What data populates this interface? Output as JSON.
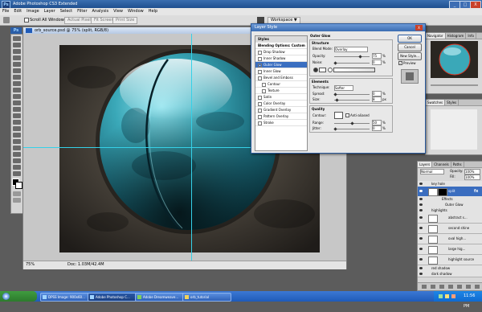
{
  "window": {
    "title": "Adobe Photoshop CS3 Extended",
    "app_logo": "Ps",
    "min": "_",
    "max": "□",
    "close": "X"
  },
  "menu": [
    "File",
    "Edit",
    "Image",
    "Layer",
    "Select",
    "Filter",
    "Analysis",
    "View",
    "Window",
    "Help"
  ],
  "options": {
    "scroll_all": "Scroll All Windows",
    "actual_pixels": "Actual Pixels",
    "fit_screen": "Fit Screen",
    "print_size": "Print Size",
    "workspace": "Workspace ▼"
  },
  "document": {
    "title": "orb_source.psd @ 75% (split, RGB/8)",
    "zoom": "75%",
    "status": "Doc: 1.03M/42.4M"
  },
  "dialog": {
    "title": "Layer Style",
    "styles_header": "Styles",
    "blending_options": "Blending Options: Custom",
    "effects": [
      {
        "label": "Drop Shadow",
        "checked": false
      },
      {
        "label": "Inner Shadow",
        "checked": false
      },
      {
        "label": "Outer Glow",
        "checked": true
      },
      {
        "label": "Inner Glow",
        "checked": false
      },
      {
        "label": "Bevel and Emboss",
        "checked": false
      },
      {
        "label": "Contour",
        "checked": false
      },
      {
        "label": "Texture",
        "checked": false
      },
      {
        "label": "Satin",
        "checked": false
      },
      {
        "label": "Color Overlay",
        "checked": false
      },
      {
        "label": "Gradient Overlay",
        "checked": false
      },
      {
        "label": "Pattern Overlay",
        "checked": false
      },
      {
        "label": "Stroke",
        "checked": false
      }
    ],
    "section_title": "Outer Glow",
    "structure": {
      "title": "Structure",
      "blend_mode_label": "Blend Mode:",
      "blend_mode": "Overlay",
      "opacity_label": "Opacity:",
      "opacity": "75",
      "noise_label": "Noise:",
      "noise": "0",
      "unit": "%",
      "opacity_level": 0.75
    },
    "elements": {
      "title": "Elements",
      "technique_label": "Technique:",
      "technique": "Softer",
      "spread_label": "Spread:",
      "spread": "0",
      "size_label": "Size:",
      "size": "8",
      "px": "px",
      "size_level": 0.04
    },
    "quality": {
      "title": "Quality",
      "contour_label": "Contour:",
      "anti_aliased": "Anti-aliased",
      "range_label": "Range:",
      "range": "50",
      "jitter_label": "Jitter:",
      "jitter": "0",
      "unit": "%",
      "range_level": 0.5
    },
    "buttons": {
      "ok": "OK",
      "cancel": "Cancel",
      "new_style": "New Style...",
      "preview": "Preview"
    },
    "preview_checked": true
  },
  "panels": {
    "navigator_tabs": [
      "Navigator",
      "Histogram",
      "Info"
    ],
    "swatch_tabs": [
      "Swatches",
      "Styles"
    ],
    "layer_tabs": [
      "Layers",
      "Channels",
      "Paths"
    ],
    "layer_blend": "Normal",
    "opacity_label": "Opacity:",
    "opacity": "100%",
    "fill_label": "Fill:",
    "fill": "100%",
    "layers": [
      {
        "name": "key hole",
        "kind": "group"
      },
      {
        "name": "split",
        "kind": "layer",
        "selected": true
      },
      {
        "name": "Effects",
        "kind": "sub"
      },
      {
        "name": "Outer Glow",
        "kind": "sub"
      },
      {
        "name": "highlights",
        "kind": "group"
      },
      {
        "name": "abstract s...",
        "kind": "layer"
      },
      {
        "name": "second shine",
        "kind": "layer"
      },
      {
        "name": "oval high...",
        "kind": "layer"
      },
      {
        "name": "large hig...",
        "kind": "layer"
      },
      {
        "name": "highlight source",
        "kind": "layer"
      },
      {
        "name": "red shadow",
        "kind": "group"
      },
      {
        "name": "dark shadow",
        "kind": "group"
      }
    ]
  },
  "taskbar": {
    "start": "",
    "items": [
      {
        "label": "DPSS Image: 900x60...",
        "active": false
      },
      {
        "label": "Adobe Photoshop C...",
        "active": true
      },
      {
        "label": "Adobe Dreamweave...",
        "active": false
      },
      {
        "label": "orb_tutorial",
        "active": false
      }
    ],
    "clock": "11:56 PM"
  },
  "colors": {
    "orb": "#3aa8b8",
    "orb_dark": "#0d3f4a",
    "guide": "#35d1e8",
    "selection": "#3b6fc1",
    "titlebar": "#2b5a9c"
  }
}
